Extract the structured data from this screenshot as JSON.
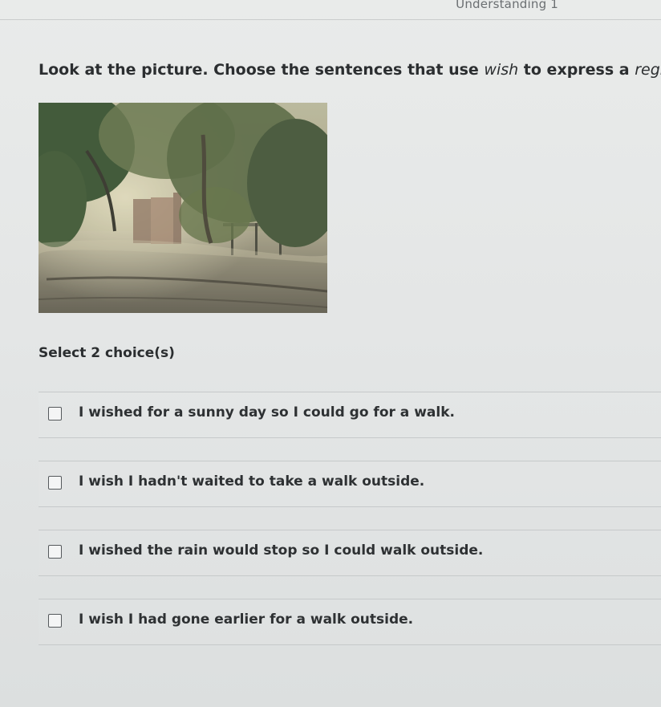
{
  "header": {
    "label": "Understanding 1"
  },
  "question": {
    "prompt_before": "Look at the picture. Choose the sentences that use ",
    "prompt_wish": "wish",
    "prompt_middle": " to express a ",
    "prompt_regret": "regret",
    "prompt_end": "."
  },
  "picture": {
    "icon": "rainy-street-photo"
  },
  "select": {
    "label": "Select 2 choice(s)"
  },
  "choices": [
    {
      "label": "I wished for a sunny day so I could go for a walk.",
      "checked": false
    },
    {
      "label": "I wish I hadn't waited to take a walk outside.",
      "checked": false
    },
    {
      "label": "I wished the rain would stop so I could walk outside.",
      "checked": false
    },
    {
      "label": "I wish I had gone earlier for a walk outside.",
      "checked": false
    }
  ],
  "colors": {
    "background": "#e6e8e8",
    "text": "#2e3133",
    "checkbox_border": "#55595c"
  }
}
